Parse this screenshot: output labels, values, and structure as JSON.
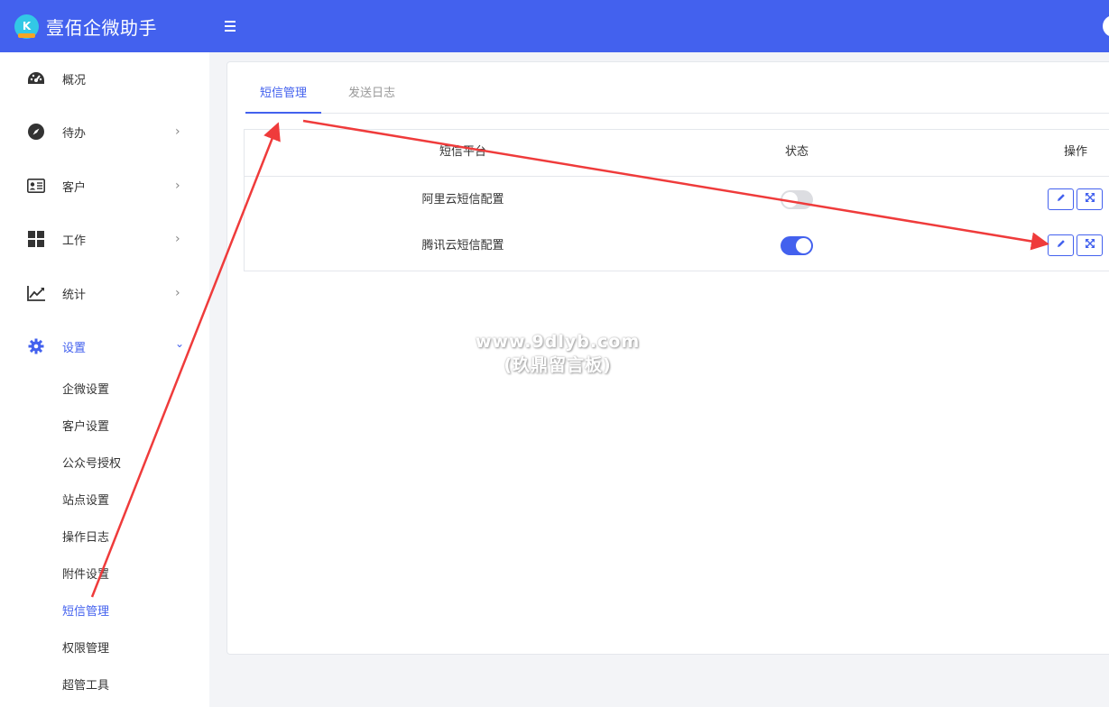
{
  "app": {
    "title": "壹佰企微助手",
    "logo_text": "K"
  },
  "colors": {
    "accent": "#4361ee",
    "annotation": "#ef3b3b"
  },
  "sidebar": {
    "items": [
      {
        "label": "概况",
        "icon": "dashboard-icon"
      },
      {
        "label": "待办",
        "icon": "compass-icon",
        "arrow": "›"
      },
      {
        "label": "客户",
        "icon": "id-card-icon",
        "arrow": "›"
      },
      {
        "label": "工作",
        "icon": "grid-icon",
        "arrow": "›"
      },
      {
        "label": "统计",
        "icon": "line-chart-icon",
        "arrow": "›"
      },
      {
        "label": "设置",
        "icon": "gear-icon",
        "arrow": "⌄"
      }
    ],
    "sub_items": [
      {
        "label": "企微设置"
      },
      {
        "label": "客户设置"
      },
      {
        "label": "公众号授权"
      },
      {
        "label": "站点设置"
      },
      {
        "label": "操作日志"
      },
      {
        "label": "附件设置"
      },
      {
        "label": "短信管理"
      },
      {
        "label": "权限管理"
      },
      {
        "label": "超管工具"
      }
    ]
  },
  "tabs": [
    {
      "label": "短信管理"
    },
    {
      "label": "发送日志"
    }
  ],
  "table": {
    "headers": [
      "短信平台",
      "状态",
      "操作"
    ],
    "rows": [
      {
        "platform": "阿里云短信配置",
        "enabled": false
      },
      {
        "platform": "腾讯云短信配置",
        "enabled": true
      }
    ]
  },
  "watermark": {
    "line1": "www.9dlyb.com",
    "line2": "(玖鼎留言板)"
  }
}
